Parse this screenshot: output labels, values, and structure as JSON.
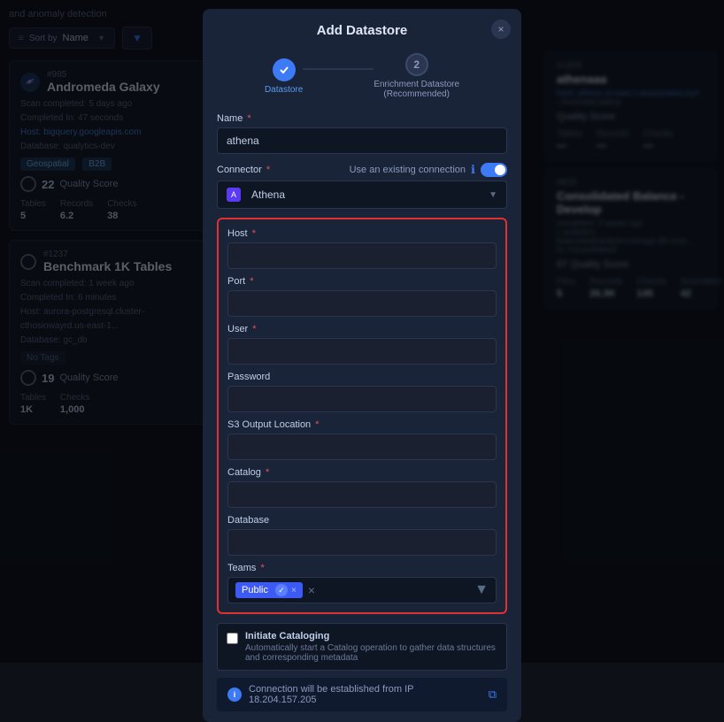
{
  "background": {
    "header_text": "and anomaly detection",
    "sort_label": "Sort by",
    "sort_value": "Name",
    "filter_icon": "▼"
  },
  "cards": [
    {
      "id": "#985",
      "title": "Andromeda Galaxy",
      "meta_scan": "Scan completed: 5 days ago",
      "meta_completed": "Completed In: 47 seconds",
      "meta_host": "Host: bigquery.googleapis.com",
      "meta_db": "Database: qualytics-dev",
      "tags": [
        "Geospatial",
        "B2B"
      ],
      "quality_score": "22",
      "quality_label": "Quality Score",
      "tables": "5",
      "records": "6.2",
      "checks": "38",
      "anomalies": ""
    },
    {
      "id": "#1237",
      "title": "Benchmark 1K Tables",
      "meta_scan": "Scan completed: 1 week ago",
      "meta_completed": "Completed In: 6 minutes",
      "meta_host": "Host: aurora-postgresql.cluster-cthosiowayrd.us-east-1...",
      "meta_db": "Database: gc_db",
      "tags": [
        "No Tags"
      ],
      "quality_score": "19",
      "quality_label": "Quality Score",
      "tables": "1K",
      "records": "",
      "checks": "1,000",
      "anomalies": ""
    }
  ],
  "right_cards": [
    {
      "id": "#1309",
      "title": "athenaaa",
      "meta_host": "Host: athene.us-east-1.amazonaws.com",
      "meta_catalog": "- AwsDataCatalog",
      "quality_label": "Quality Score",
      "tables": "—",
      "records": "—",
      "checks": "—",
      "anomalies": "—"
    },
    {
      "id": "#603",
      "title": "Consolidated Balance - Develop",
      "meta_completed": "completed: 3 weeks ago",
      "meta_in": "ed In: 35 minutes",
      "meta_host": "t: qualytics-financials@qualyticsstorage.dfs.core...",
      "meta_path": "fs: /consolidated/",
      "quality_score": "67",
      "quality_label": "Quality Score",
      "files": "5",
      "records": "26.3K",
      "checks": "145",
      "anomalies": "42"
    }
  ],
  "modal": {
    "title": "Add Datastore",
    "close_label": "×",
    "step1_label": "Datastore",
    "step2_number": "2",
    "step2_label": "Enrichment Datastore\n(Recommended)",
    "name_label": "Name",
    "name_required": true,
    "name_value": "athena",
    "connector_label": "Connector",
    "use_existing_label": "Use an existing connection",
    "connector_value": "Athena",
    "host_label": "Host",
    "host_required": true,
    "host_value": "",
    "port_label": "Port",
    "port_required": true,
    "port_value": "",
    "user_label": "User",
    "user_required": true,
    "user_value": "",
    "password_label": "Password",
    "password_value": "",
    "s3_label": "S3 Output Location",
    "s3_required": true,
    "s3_value": "",
    "catalog_label": "Catalog",
    "catalog_required": true,
    "catalog_value": "",
    "database_label": "Database",
    "database_value": "",
    "teams_label": "Teams",
    "teams_required": true,
    "teams_tag": "Public",
    "checkbox_title": "Initiate Cataloging",
    "checkbox_desc": "Automatically start a Catalog operation to gather data structures and corresponding metadata",
    "footer_text": "Connection will be established from IP 18.204.157.205"
  }
}
